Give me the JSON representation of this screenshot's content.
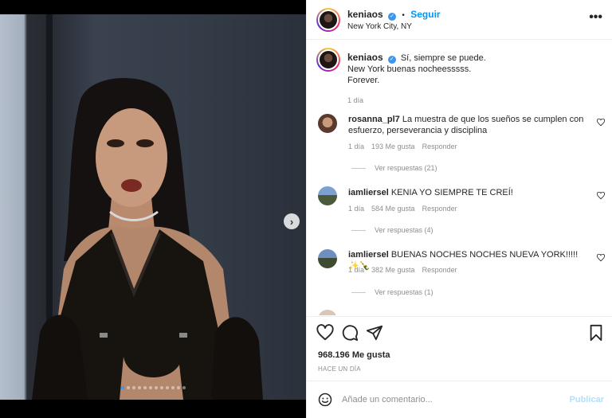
{
  "post": {
    "username": "keniaos",
    "follow_label": "Seguir",
    "separator": "•",
    "location": "New York City, NY",
    "more_label": "•••"
  },
  "caption": {
    "username": "keniaos",
    "line1": "Sí, siempre se puede.",
    "line2": "New York buenas nocheesssss.",
    "line3": "Forever.",
    "time": "1 día"
  },
  "comments": [
    {
      "username": "rosanna_pl7",
      "text": "La muestra de que los sueños se cumplen con esfuerzo, perseverancia y disciplina",
      "time": "1 día",
      "likes": "193 Me gusta",
      "reply": "Responder",
      "view_replies": "Ver respuestas (21)"
    },
    {
      "username": "iamliersel",
      "text": "KENIA YO SIEMPRE TE CREÍ!",
      "time": "1 día",
      "likes": "584 Me gusta",
      "reply": "Responder",
      "view_replies": "Ver respuestas (4)"
    },
    {
      "username": "iamliersel",
      "text": "BUENAS NOCHES NOCHES NUEVA YORK!!!!!",
      "emoji": "✨🍾",
      "time": "1 día",
      "likes": "382 Me gusta",
      "reply": "Responder",
      "view_replies": "Ver respuestas (1)"
    }
  ],
  "engagement": {
    "likes": "968.196 Me gusta",
    "posted": "HACE UN DÍA"
  },
  "composer": {
    "placeholder": "Añade un comentario...",
    "publish_label": "Publicar"
  },
  "carousel": {
    "total_slides": 12,
    "active_index": 0,
    "next_glyph": "›"
  },
  "colors": {
    "link_blue": "#0095f6",
    "verified_blue": "#3897f0",
    "publish_disabled": "#b2dffc",
    "muted_text": "#8e8e8e"
  },
  "icons": {
    "verified": "verified-badge-icon",
    "like": "heart-icon",
    "comment": "comment-icon",
    "share": "paper-plane-icon",
    "save": "bookmark-icon",
    "emoji": "smiley-icon",
    "next": "chevron-right-icon"
  }
}
